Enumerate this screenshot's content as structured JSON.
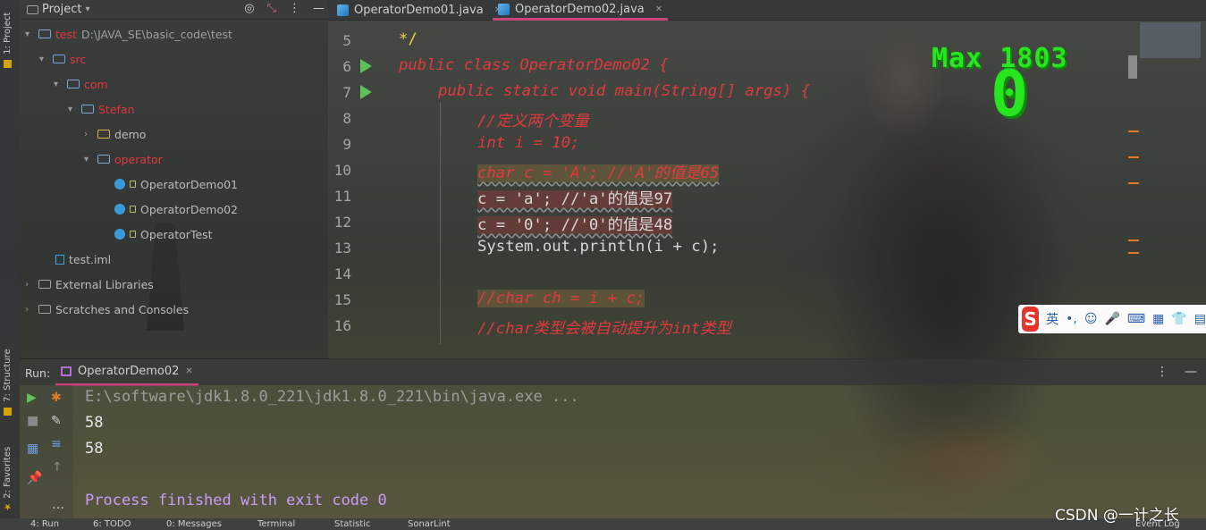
{
  "project_pane": {
    "title": "Project",
    "tree": [
      {
        "label": "test",
        "path": "D:\\JAVA_SE\\basic_code\\test"
      },
      {
        "label": "src"
      },
      {
        "label": "com"
      },
      {
        "label": "Stefan"
      },
      {
        "label": "demo"
      },
      {
        "label": "operator"
      },
      {
        "label": "OperatorDemo01"
      },
      {
        "label": "OperatorDemo02"
      },
      {
        "label": "OperatorTest"
      },
      {
        "label": "test.iml"
      },
      {
        "label": "External Libraries"
      },
      {
        "label": "Scratches and Consoles"
      }
    ]
  },
  "left_strip": {
    "project_tab": "1: Project",
    "structure_tab": "7: Structure",
    "favorites_tab": "2: Favorites"
  },
  "editor_tabs": [
    {
      "label": "OperatorDemo01.java"
    },
    {
      "label": "OperatorDemo02.java"
    }
  ],
  "editor": {
    "line_numbers": [
      "5",
      "6",
      "7",
      "8",
      "9",
      "10",
      "11",
      "12",
      "13",
      "14",
      "15",
      "16"
    ],
    "lines": [
      "*/",
      "public class OperatorDemo02 {",
      "public static void main(String[] args) {",
      "//定义两个变量",
      "int i = 10;",
      "char c = 'A'; //'A'的值是65",
      "c = 'a'; //'a'的值是97",
      "c = '0'; //'0'的值是48",
      "System.out.println(i + c);",
      "",
      "//char ch = i + c;",
      "//char类型会被自动提升为int类型"
    ]
  },
  "overlay": {
    "score_label": "Max 1803",
    "score_value": "0",
    "ime_lang": "英",
    "ime_punct": "•,"
  },
  "run_panel": {
    "label": "Run:",
    "tab": "OperatorDemo02",
    "console": [
      "E:\\software\\jdk1.8.0_221\\jdk1.8.0_221\\bin\\java.exe ...",
      "58",
      "58",
      "",
      "Process finished with exit code 0"
    ]
  },
  "status_bar": {
    "items": [
      "4: Run",
      "6: TODO",
      "0: Messages",
      "Terminal",
      "Statistic",
      "SonarLint",
      "Event Log"
    ]
  },
  "watermark": "CSDN @一计之长",
  "colors": {
    "keyword": "#e23a3f",
    "string": "#7ad24d",
    "number": "#d5a6ff",
    "field": "#46b6e8",
    "tab_underline": "#c9447a",
    "game_green": "#28e61e"
  }
}
